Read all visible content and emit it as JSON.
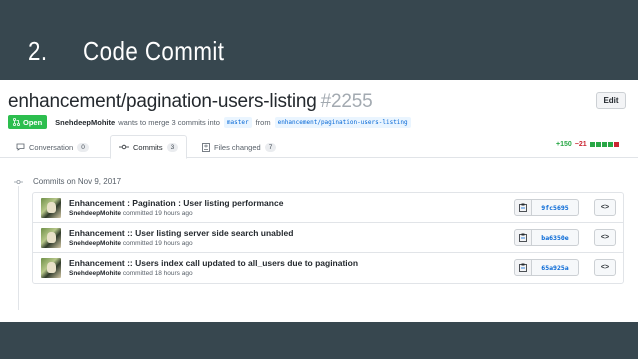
{
  "slide": {
    "number": "2.",
    "title": "Code Commit"
  },
  "pr": {
    "title": "enhancement/pagination-users-listing",
    "number": "#2255",
    "edit_label": "Edit",
    "state_label": "Open",
    "author": "SnehdeepMohite",
    "merge_text": "wants to merge 3 commits into",
    "base_branch": "master",
    "from_text": "from",
    "head_branch": "enhancement/pagination-users-listing"
  },
  "tabs": [
    {
      "label": "Conversation",
      "count": "0",
      "icon": "comment-icon"
    },
    {
      "label": "Commits",
      "count": "3",
      "icon": "commit-icon"
    },
    {
      "label": "Files changed",
      "count": "7",
      "icon": "file-diff-icon"
    }
  ],
  "diffstat": {
    "additions": "+150",
    "deletions": "−21",
    "blocks": [
      "#28a745",
      "#28a745",
      "#28a745",
      "#28a745",
      "#cb2431"
    ]
  },
  "timeline": {
    "day_label": "Commits on Nov 9, 2017"
  },
  "commits": [
    {
      "message": "Enhancement : Pagination : User listing performance",
      "author": "SnehdeepMohite",
      "committed_text": "committed",
      "time": "19 hours ago",
      "sha": "9fc5695"
    },
    {
      "message": "Enhancement :: User listing server side search unabled",
      "author": "SnehdeepMohite",
      "committed_text": "committed",
      "time": "19 hours ago",
      "sha": "ba6350e"
    },
    {
      "message": "Enhancement :: Users index call updated to all_users due to pagination",
      "author": "SnehdeepMohite",
      "committed_text": "committed",
      "time": "18 hours ago",
      "sha": "65a925a"
    }
  ],
  "colors": {
    "background": "#37474f",
    "open_badge": "#2cbe4e",
    "link": "#0366d6"
  }
}
